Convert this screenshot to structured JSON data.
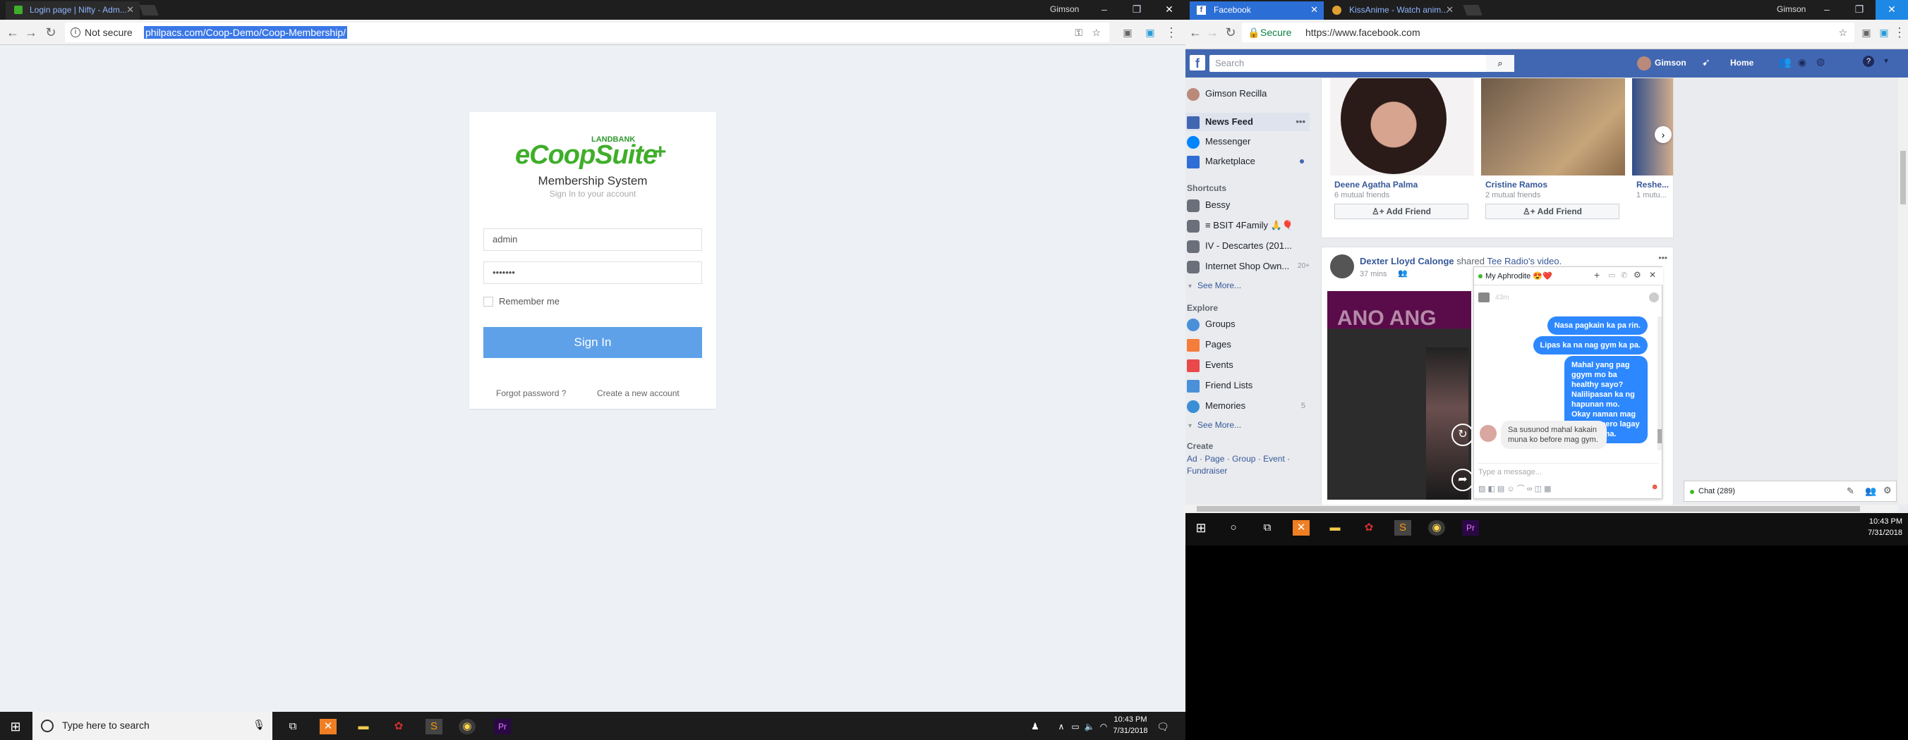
{
  "left_browser": {
    "tab_title": "Login page | Nifty - Adm...",
    "user_label": "Gimson",
    "security_label": "Not secure",
    "url": "philpacs.com/Coop-Demo/Coop-Membership/",
    "login": {
      "brand_top": "LANDBANK",
      "brand_logo": "eCoopSuite",
      "title": "Membership System",
      "subtitle": "Sign In to your account",
      "username_value": "admin",
      "password_value": "•••••••",
      "remember_label": "Remember me",
      "signin_label": "Sign In",
      "forgot_label": "Forgot password ?",
      "create_label": "Create a new account"
    }
  },
  "left_taskbar": {
    "search_placeholder": "Type here to search",
    "time": "10:43 PM",
    "date": "7/31/2018"
  },
  "right_browser": {
    "tabs": [
      {
        "label": "Facebook"
      },
      {
        "label": "KissAnime - Watch anim..."
      }
    ],
    "user_label": "Gimson",
    "security_label": "Secure",
    "url": "https://www.facebook.com"
  },
  "facebook": {
    "search_placeholder": "Search",
    "profile_name": "Gimson",
    "home_label": "Home",
    "sidebar": {
      "user": "Gimson Recilla",
      "news_feed": "News Feed",
      "messenger": "Messenger",
      "marketplace": "Marketplace",
      "shortcuts_heading": "Shortcuts",
      "shortcuts": [
        "Bessy",
        "≡ BSIT 4Family 🙏🎈",
        "IV - Descartes (201...",
        "Internet Shop Own..."
      ],
      "shop_count": "20+",
      "see_more_1": "See More...",
      "explore_heading": "Explore",
      "explore": [
        "Groups",
        "Pages",
        "Events",
        "Friend Lists",
        "Memories"
      ],
      "memories_count": "5",
      "see_more_2": "See More...",
      "create_heading": "Create",
      "create_links": [
        "Ad",
        "Page",
        "Group",
        "Event"
      ],
      "create_fundraiser": "Fundraiser"
    },
    "suggestions": [
      {
        "name": "Deene Agatha Palma",
        "mutual": "6 mutual friends",
        "button": "Add Friend"
      },
      {
        "name": "Cristine Ramos",
        "mutual": "2 mutual friends",
        "button": "Add Friend"
      },
      {
        "name": "Reshe...",
        "mutual": "1 mutu..."
      }
    ],
    "post": {
      "author": "Dexter Lloyd Calonge",
      "action": "shared",
      "page": "Tee Radio's video.",
      "time": "37 mins",
      "video_text": "ANO ANG"
    },
    "chat_window": {
      "title": "My Aphrodite 😍❤️",
      "time_label": "43m",
      "messages_out": [
        "Nasa pagkain ka pa rin.",
        "Lipas ka na nag gym ka pa.",
        "Mahal yang pag ggym mo ba healthy sayo? Nalilipasan ka ng hapunan mo. Okay naman mag gym eh pero lagay mo sa tama."
      ],
      "message_in": "Sa susunod mahal kakain muna ko before mag gym.",
      "input_placeholder": "Type a message..."
    },
    "chat_bar": "Chat (289)"
  },
  "right_taskbar": {
    "time": "10:43 PM",
    "date": "7/31/2018"
  },
  "colors": {
    "signin_blue": "#5ea1e9",
    "facebook_blue": "#4267b2",
    "messenger_blue": "#2d88ff",
    "brand_green": "#3fae2a"
  }
}
